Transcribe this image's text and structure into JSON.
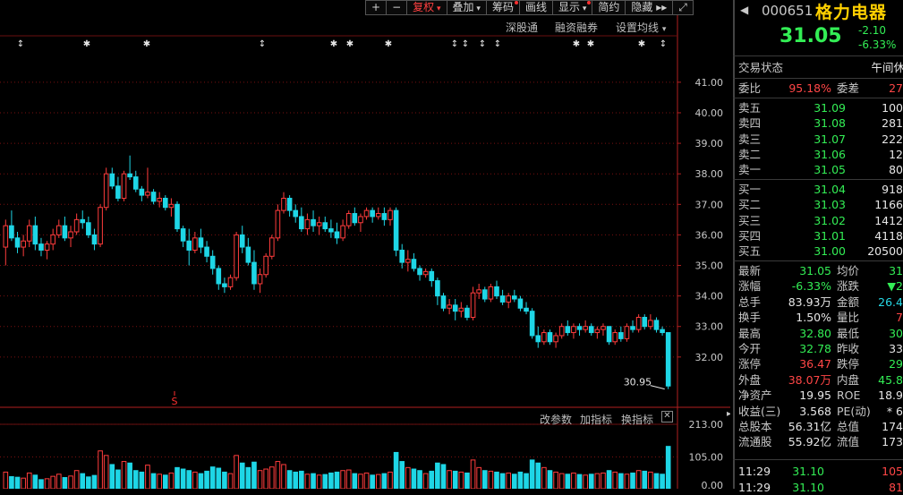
{
  "toolbar": {
    "items": [
      {
        "label": "+",
        "active": false,
        "dot": false,
        "dropdown": false
      },
      {
        "label": "−",
        "active": false,
        "dot": false,
        "dropdown": false
      },
      {
        "label": "复权",
        "active": true,
        "dot": false,
        "dropdown": true
      },
      {
        "label": "叠加",
        "active": false,
        "dot": false,
        "dropdown": true
      },
      {
        "label": "筹码",
        "active": false,
        "dot": true,
        "dropdown": false
      },
      {
        "label": "画线",
        "active": false,
        "dot": false,
        "dropdown": false
      },
      {
        "label": "显示",
        "active": false,
        "dot": true,
        "dropdown": true
      },
      {
        "label": "简约",
        "active": false,
        "dot": false,
        "dropdown": false
      },
      {
        "label": "隐藏 ▸▸",
        "active": false,
        "dot": false,
        "dropdown": false
      },
      {
        "label": "⤢",
        "active": false,
        "dot": false,
        "dropdown": false
      }
    ]
  },
  "menu": {
    "shenzhen": "深股通",
    "margin": "融资融券",
    "ma_setting": "设置均线"
  },
  "indicator_menu": {
    "params": "改参数",
    "add": "加指标",
    "swap": "换指标"
  },
  "price_axis": [
    "41.00",
    "40.00",
    "39.00",
    "38.00",
    "37.00",
    "36.00",
    "35.00",
    "34.00",
    "33.00",
    "32.00"
  ],
  "vol_axis": [
    "213.00",
    "105.00",
    "0.00"
  ],
  "last_price_label": "30.95",
  "event_marker": "S",
  "colors": {
    "up": "#ff3c3c",
    "down": "#1ed6e6",
    "bg": "#000000",
    "grid": "#7a1010"
  },
  "chart_data": {
    "type": "candlestick",
    "note": "daily OHLC, left to right",
    "ohlc": [
      [
        35.6,
        36.5,
        35.0,
        36.3
      ],
      [
        36.3,
        36.8,
        35.8,
        35.9
      ],
      [
        35.9,
        36.1,
        35.4,
        35.6
      ],
      [
        35.6,
        36.0,
        35.3,
        35.8
      ],
      [
        35.8,
        36.5,
        35.6,
        36.3
      ],
      [
        36.3,
        36.6,
        35.5,
        35.7
      ],
      [
        35.7,
        35.9,
        35.3,
        35.5
      ],
      [
        35.5,
        35.8,
        35.2,
        35.7
      ],
      [
        35.7,
        36.2,
        35.5,
        36.0
      ],
      [
        36.0,
        36.5,
        35.9,
        36.3
      ],
      [
        36.3,
        36.6,
        35.8,
        35.9
      ],
      [
        35.9,
        36.3,
        35.6,
        36.1
      ],
      [
        36.1,
        36.7,
        36.0,
        36.5
      ],
      [
        36.5,
        36.8,
        36.2,
        36.4
      ],
      [
        36.4,
        36.6,
        35.9,
        36.0
      ],
      [
        36.0,
        36.2,
        35.5,
        35.7
      ],
      [
        35.7,
        37.0,
        35.6,
        36.9
      ],
      [
        36.9,
        38.2,
        36.8,
        38.0
      ],
      [
        38.0,
        38.2,
        37.5,
        37.6
      ],
      [
        37.6,
        37.9,
        37.1,
        37.2
      ],
      [
        37.2,
        38.1,
        37.1,
        38.0
      ],
      [
        38.0,
        38.6,
        37.8,
        37.9
      ],
      [
        37.9,
        38.1,
        37.4,
        37.5
      ],
      [
        37.5,
        37.6,
        37.1,
        37.3
      ],
      [
        37.3,
        38.2,
        37.2,
        37.4
      ],
      [
        37.4,
        37.5,
        37.0,
        37.1
      ],
      [
        37.1,
        37.4,
        36.9,
        37.2
      ],
      [
        37.2,
        37.3,
        36.8,
        36.9
      ],
      [
        36.9,
        37.2,
        36.6,
        37.0
      ],
      [
        37.0,
        37.1,
        36.1,
        36.2
      ],
      [
        36.2,
        36.3,
        35.6,
        35.8
      ],
      [
        35.8,
        36.2,
        35.0,
        35.5
      ],
      [
        35.5,
        36.1,
        35.4,
        35.9
      ],
      [
        35.9,
        36.2,
        35.4,
        35.6
      ],
      [
        35.6,
        35.8,
        35.1,
        35.3
      ],
      [
        35.3,
        35.5,
        34.7,
        34.9
      ],
      [
        34.9,
        35.0,
        34.2,
        34.4
      ],
      [
        34.4,
        34.6,
        34.1,
        34.3
      ],
      [
        34.3,
        34.7,
        34.2,
        34.6
      ],
      [
        34.6,
        36.1,
        34.5,
        36.0
      ],
      [
        36.0,
        36.3,
        35.4,
        35.6
      ],
      [
        35.6,
        35.9,
        35.0,
        35.1
      ],
      [
        35.1,
        35.5,
        34.2,
        34.4
      ],
      [
        34.4,
        34.9,
        34.1,
        34.7
      ],
      [
        34.7,
        35.4,
        34.6,
        35.3
      ],
      [
        35.3,
        36.0,
        35.2,
        35.9
      ],
      [
        35.9,
        37.0,
        35.8,
        36.8
      ],
      [
        36.8,
        37.4,
        36.7,
        37.2
      ],
      [
        37.2,
        37.3,
        36.6,
        36.8
      ],
      [
        36.8,
        37.0,
        36.4,
        36.6
      ],
      [
        36.6,
        36.9,
        36.1,
        36.2
      ],
      [
        36.2,
        36.7,
        36.0,
        36.5
      ],
      [
        36.5,
        36.8,
        36.1,
        36.3
      ],
      [
        36.3,
        36.6,
        36.0,
        36.4
      ],
      [
        36.4,
        36.6,
        36.1,
        36.2
      ],
      [
        36.2,
        36.5,
        35.9,
        36.1
      ],
      [
        36.1,
        36.4,
        35.7,
        35.9
      ],
      [
        35.9,
        36.5,
        35.8,
        36.3
      ],
      [
        36.3,
        36.8,
        36.2,
        36.7
      ],
      [
        36.7,
        36.9,
        36.3,
        36.4
      ],
      [
        36.4,
        36.7,
        36.1,
        36.6
      ],
      [
        36.6,
        36.9,
        36.5,
        36.8
      ],
      [
        36.8,
        36.9,
        36.4,
        36.6
      ],
      [
        36.6,
        36.9,
        36.5,
        36.7
      ],
      [
        36.7,
        36.9,
        36.3,
        36.5
      ],
      [
        36.5,
        36.9,
        36.3,
        36.8
      ],
      [
        36.8,
        36.9,
        35.3,
        35.5
      ],
      [
        35.5,
        35.7,
        34.9,
        35.1
      ],
      [
        35.1,
        35.5,
        34.8,
        35.2
      ],
      [
        35.2,
        35.4,
        34.8,
        34.9
      ],
      [
        34.9,
        35.0,
        34.5,
        34.7
      ],
      [
        34.7,
        34.9,
        34.6,
        34.8
      ],
      [
        34.8,
        34.9,
        34.3,
        34.5
      ],
      [
        34.5,
        34.6,
        33.7,
        34.0
      ],
      [
        34.0,
        34.1,
        33.5,
        33.6
      ],
      [
        33.6,
        33.9,
        33.4,
        33.7
      ],
      [
        33.7,
        33.9,
        33.2,
        33.5
      ],
      [
        33.5,
        33.8,
        33.3,
        33.6
      ],
      [
        33.6,
        33.7,
        33.2,
        33.3
      ],
      [
        33.3,
        34.3,
        33.2,
        34.1
      ],
      [
        34.1,
        34.4,
        33.9,
        34.2
      ],
      [
        34.2,
        34.3,
        33.8,
        33.9
      ],
      [
        33.9,
        34.4,
        33.8,
        34.3
      ],
      [
        34.3,
        34.5,
        33.9,
        34.0
      ],
      [
        34.0,
        34.2,
        33.7,
        33.8
      ],
      [
        33.8,
        34.1,
        33.6,
        34.0
      ],
      [
        34.0,
        34.2,
        33.8,
        33.9
      ],
      [
        33.9,
        34.0,
        33.5,
        33.6
      ],
      [
        33.6,
        33.8,
        33.4,
        33.5
      ],
      [
        33.5,
        33.6,
        32.6,
        32.7
      ],
      [
        32.7,
        33.0,
        32.3,
        32.5
      ],
      [
        32.5,
        32.9,
        32.4,
        32.8
      ],
      [
        32.8,
        32.9,
        32.4,
        32.5
      ],
      [
        32.5,
        32.8,
        32.3,
        32.7
      ],
      [
        32.7,
        33.1,
        32.6,
        33.0
      ],
      [
        33.0,
        33.2,
        32.7,
        32.8
      ],
      [
        32.8,
        33.1,
        32.6,
        33.0
      ],
      [
        33.0,
        33.1,
        32.7,
        32.9
      ],
      [
        32.9,
        33.2,
        32.8,
        33.0
      ],
      [
        33.0,
        33.1,
        32.7,
        32.8
      ],
      [
        32.8,
        33.0,
        32.6,
        32.9
      ],
      [
        32.9,
        33.1,
        32.7,
        33.0
      ],
      [
        33.0,
        33.0,
        32.4,
        32.5
      ],
      [
        32.5,
        32.9,
        32.4,
        32.8
      ],
      [
        32.8,
        33.0,
        32.5,
        32.6
      ],
      [
        32.6,
        33.1,
        32.5,
        33.0
      ],
      [
        33.0,
        33.2,
        32.8,
        32.9
      ],
      [
        32.9,
        33.4,
        32.8,
        33.3
      ],
      [
        33.3,
        33.4,
        32.9,
        33.0
      ],
      [
        33.0,
        33.4,
        32.9,
        33.2
      ],
      [
        33.2,
        33.3,
        32.8,
        32.9
      ],
      [
        32.9,
        33.0,
        32.7,
        32.8
      ],
      [
        32.8,
        32.8,
        30.95,
        31.05
      ]
    ],
    "volumes": [
      55,
      40,
      38,
      35,
      52,
      45,
      30,
      33,
      41,
      48,
      37,
      42,
      60,
      50,
      39,
      44,
      125,
      110,
      80,
      62,
      90,
      85,
      60,
      55,
      78,
      50,
      48,
      45,
      52,
      70,
      65,
      60,
      55,
      50,
      58,
      72,
      68,
      55,
      50,
      110,
      85,
      70,
      88,
      60,
      65,
      72,
      90,
      80,
      60,
      55,
      58,
      48,
      50,
      45,
      47,
      52,
      55,
      60,
      62,
      50,
      48,
      52,
      45,
      47,
      50,
      55,
      120,
      90,
      70,
      65,
      60,
      50,
      58,
      85,
      80,
      60,
      58,
      55,
      52,
      95,
      70,
      60,
      58,
      55,
      50,
      52,
      48,
      55,
      50,
      95,
      85,
      70,
      60,
      55,
      50,
      48,
      52,
      47,
      45,
      48,
      50,
      52,
      60,
      55,
      50,
      48,
      52,
      60,
      58,
      55,
      50,
      48,
      140
    ],
    "price_ylim": [
      30.5,
      41.7
    ],
    "vol_ylim": [
      0,
      213
    ]
  },
  "quote": {
    "code": "000651",
    "name": "格力电器",
    "price": "31.05",
    "change": "-2.10",
    "change_pct": "-6.33%",
    "status_label": "交易状态",
    "status_value": "午间休",
    "weibi_label": "委比",
    "weibi": "95.18%",
    "weicha_label": "委差",
    "weicha": "27",
    "asks": [
      {
        "label": "卖五",
        "price": "31.09",
        "vol": "100"
      },
      {
        "label": "卖四",
        "price": "31.08",
        "vol": "281"
      },
      {
        "label": "卖三",
        "price": "31.07",
        "vol": "222"
      },
      {
        "label": "卖二",
        "price": "31.06",
        "vol": "12"
      },
      {
        "label": "卖一",
        "price": "31.05",
        "vol": "80"
      }
    ],
    "bids": [
      {
        "label": "买一",
        "price": "31.04",
        "vol": "918"
      },
      {
        "label": "买二",
        "price": "31.03",
        "vol": "1166"
      },
      {
        "label": "买三",
        "price": "31.02",
        "vol": "1412"
      },
      {
        "label": "买四",
        "price": "31.01",
        "vol": "4118"
      },
      {
        "label": "买五",
        "price": "31.00",
        "vol": "20500"
      }
    ],
    "stats": [
      {
        "l1": "最新",
        "v1": "31.05",
        "c1": "g",
        "l2": "均价",
        "v2": "31",
        "c2": "g"
      },
      {
        "l1": "涨幅",
        "v1": "-6.33%",
        "c1": "g",
        "l2": "涨跌",
        "v2": "▼2",
        "c2": "g"
      },
      {
        "l1": "总手",
        "v1": "83.93万",
        "c1": "w",
        "l2": "金额",
        "v2": "26.4",
        "c2": "c"
      },
      {
        "l1": "换手",
        "v1": "1.50%",
        "c1": "w",
        "l2": "量比",
        "v2": "7",
        "c2": "r"
      },
      {
        "l1": "最高",
        "v1": "32.80",
        "c1": "g",
        "l2": "最低",
        "v2": "30",
        "c2": "g"
      },
      {
        "l1": "今开",
        "v1": "32.78",
        "c1": "g",
        "l2": "昨收",
        "v2": "33",
        "c2": "w"
      },
      {
        "l1": "涨停",
        "v1": "36.47",
        "c1": "r",
        "l2": "跌停",
        "v2": "29",
        "c2": "g"
      },
      {
        "l1": "外盘",
        "v1": "38.07万",
        "c1": "r",
        "l2": "内盘",
        "v2": "45.8",
        "c2": "g"
      },
      {
        "l1": "净资产",
        "v1": "19.95",
        "c1": "w",
        "l2": "ROE",
        "v2": "18.9",
        "c2": "w"
      },
      {
        "l1": "收益(三)",
        "v1": "3.568",
        "c1": "w",
        "l2": "PE(动)",
        "v2": "* 6",
        "c2": "w"
      },
      {
        "l1": "总股本",
        "v1": "56.31亿",
        "c1": "w",
        "l2": "总值",
        "v2": "174",
        "c2": "w"
      },
      {
        "l1": "流通股",
        "v1": "55.92亿",
        "c1": "w",
        "l2": "流值",
        "v2": "173",
        "c2": "w"
      }
    ],
    "ticks": [
      {
        "time": "11:29",
        "price": "31.10",
        "vol": "105"
      },
      {
        "time": "11:29",
        "price": "31.10",
        "vol": "81"
      }
    ]
  }
}
